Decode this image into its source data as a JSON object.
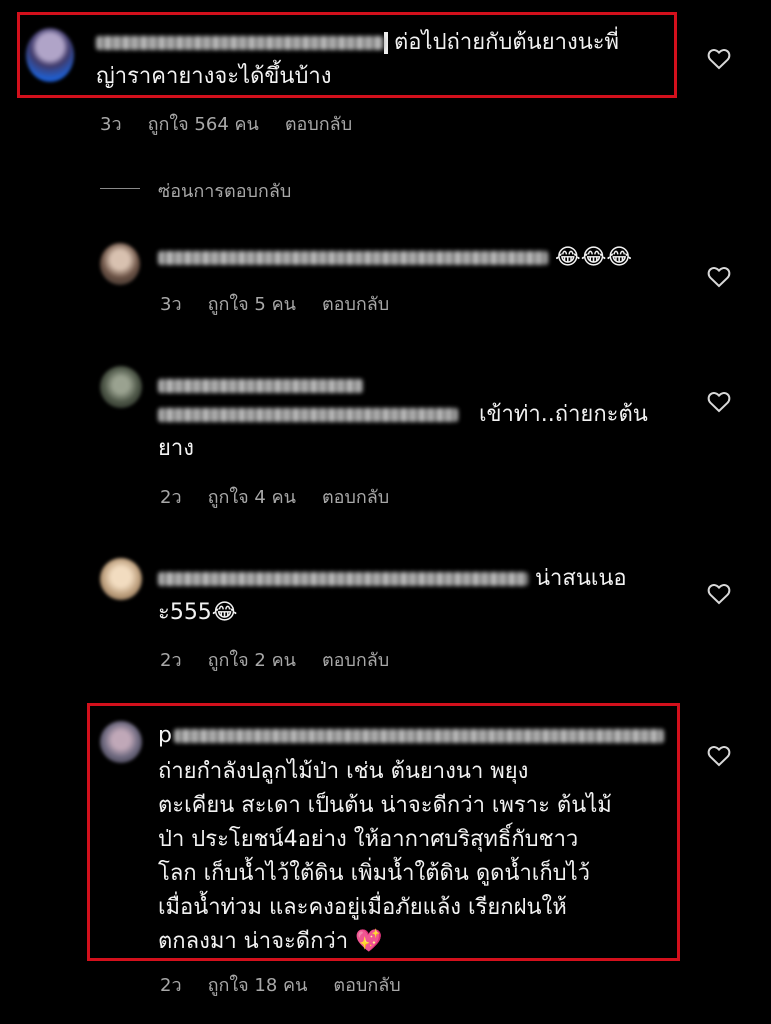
{
  "comments": [
    {
      "text": "ต่อไปถ่ายกับต้นยางนะพี่ญ่าราคายางจะได้ขึ้นบ้าง",
      "line1": "ต่อไปถ่ายกับต้นยางนะพี่",
      "line2": "ญ่าราคายางจะได้ขึ้นบ้าง",
      "time": "3ว",
      "likes": "ถูกใจ 564 คน",
      "reply": "ตอบกลับ"
    },
    {
      "text": "😂😂😂",
      "time": "3ว",
      "likes": "ถูกใจ 5 คน",
      "reply": "ตอบกลับ"
    },
    {
      "line1": "เข้าท่า..ถ่ายกะต้น",
      "line2": "ยาง",
      "time": "2ว",
      "likes": "ถูกใจ 4 คน",
      "reply": "ตอบกลับ"
    },
    {
      "line1": "น่าสนเนอ",
      "line2": "ะ555😂",
      "time": "2ว",
      "likes": "ถูกใจ 2 คน",
      "reply": "ตอบกลับ"
    },
    {
      "lines": [
        "ถ่ายกำลังปลูกไม้ป่า เช่น ต้นยางนา พยุง",
        "ตะเคียน สะเดา เป็นต้น น่าจะดีกว่า เพราะ ต้นไม้",
        "ป่า ประโยชน์4อย่าง ให้อากาศบริสุทธิ์กับชาว",
        "โลก เก็บน้ำไว้ใต้ดิน เพิ่มน้ำใต้ดิน ดูดน้ำเก็บไว้",
        "เมื่อน้ำท่วม และคงอยู่เมื่อภัยแล้ง เรียกฝนให้",
        "ตกลงมา น่าจะดีกว่า 💖"
      ],
      "name_prefix": "p",
      "time": "2ว",
      "likes": "ถูกใจ 18 คน",
      "reply": "ตอบกลับ"
    }
  ],
  "hide_replies": "ซ่อนการตอบกลับ",
  "colors": {
    "background": "#000000",
    "text": "#f2f2f2",
    "meta": "#a8a8a8",
    "highlight": "#d3101c"
  },
  "icons": {
    "like": "heart-outline-icon"
  }
}
